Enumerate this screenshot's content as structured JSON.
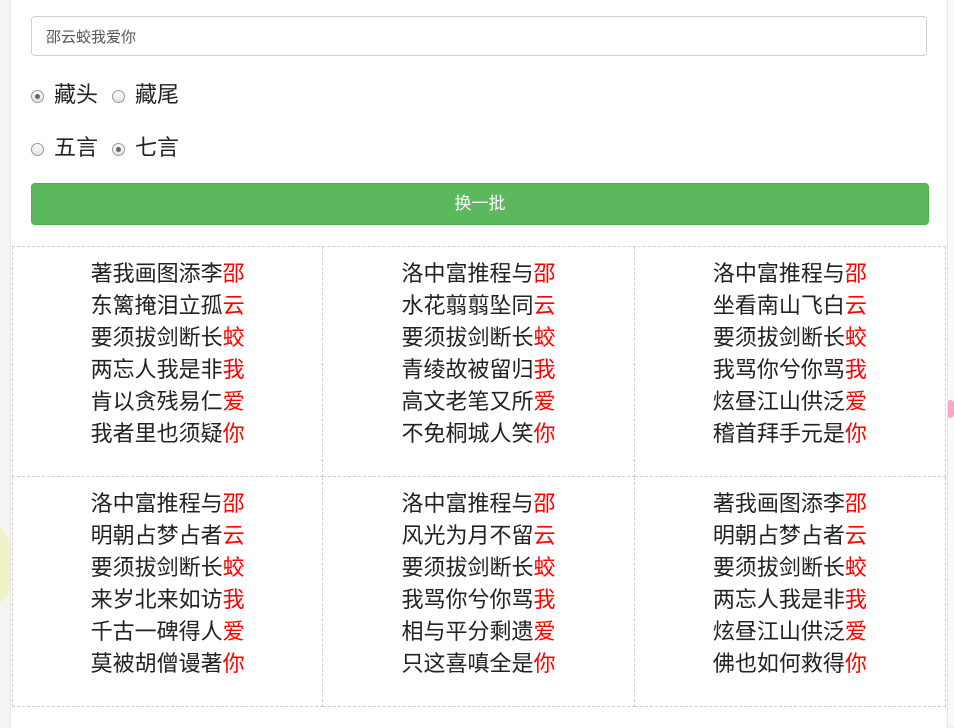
{
  "search": {
    "value": "邵云蛟我爱你",
    "placeholder": ""
  },
  "mode": {
    "options": [
      {
        "label": "藏头",
        "checked": true
      },
      {
        "label": "藏尾",
        "checked": false
      }
    ]
  },
  "length": {
    "options": [
      {
        "label": "五言",
        "checked": false
      },
      {
        "label": "七言",
        "checked": true
      }
    ]
  },
  "refresh_button": {
    "label": "换一批"
  },
  "colors": {
    "accent": "#5cb85c",
    "highlight": "#ff0000"
  },
  "poems": [
    {
      "lines": [
        {
          "body": "著我画图添李",
          "last": "邵"
        },
        {
          "body": "东篱掩泪立孤",
          "last": "云"
        },
        {
          "body": "要须拔剑断长",
          "last": "蛟"
        },
        {
          "body": "两忘人我是非",
          "last": "我"
        },
        {
          "body": "肯以贪残易仁",
          "last": "爱"
        },
        {
          "body": "我者里也须疑",
          "last": "你"
        }
      ]
    },
    {
      "lines": [
        {
          "body": "洛中富推程与",
          "last": "邵"
        },
        {
          "body": "水花翦翦坠同",
          "last": "云"
        },
        {
          "body": "要须拔剑断长",
          "last": "蛟"
        },
        {
          "body": "青绫故被留归",
          "last": "我"
        },
        {
          "body": "高文老笔又所",
          "last": "爱"
        },
        {
          "body": "不免桐城人笑",
          "last": "你"
        }
      ]
    },
    {
      "lines": [
        {
          "body": "洛中富推程与",
          "last": "邵"
        },
        {
          "body": "坐看南山飞白",
          "last": "云"
        },
        {
          "body": "要须拔剑断长",
          "last": "蛟"
        },
        {
          "body": "我骂你兮你骂",
          "last": "我"
        },
        {
          "body": "炫昼江山供泛",
          "last": "爱"
        },
        {
          "body": "稽首拜手元是",
          "last": "你"
        }
      ]
    },
    {
      "lines": [
        {
          "body": "洛中富推程与",
          "last": "邵"
        },
        {
          "body": "明朝占梦占者",
          "last": "云"
        },
        {
          "body": "要须拔剑断长",
          "last": "蛟"
        },
        {
          "body": "来岁北来如访",
          "last": "我"
        },
        {
          "body": "千古一碑得人",
          "last": "爱"
        },
        {
          "body": "莫被胡僧谩著",
          "last": "你"
        }
      ]
    },
    {
      "lines": [
        {
          "body": "洛中富推程与",
          "last": "邵"
        },
        {
          "body": "风光为月不留",
          "last": "云"
        },
        {
          "body": "要须拔剑断长",
          "last": "蛟"
        },
        {
          "body": "我骂你兮你骂",
          "last": "我"
        },
        {
          "body": "相与平分剩遗",
          "last": "爱"
        },
        {
          "body": "只这喜嗔全是",
          "last": "你"
        }
      ]
    },
    {
      "lines": [
        {
          "body": "著我画图添李",
          "last": "邵"
        },
        {
          "body": "明朝占梦占者",
          "last": "云"
        },
        {
          "body": "要须拔剑断长",
          "last": "蛟"
        },
        {
          "body": "两忘人我是非",
          "last": "我"
        },
        {
          "body": "炫昼江山供泛",
          "last": "爱"
        },
        {
          "body": "佛也如何救得",
          "last": "你"
        }
      ]
    }
  ]
}
